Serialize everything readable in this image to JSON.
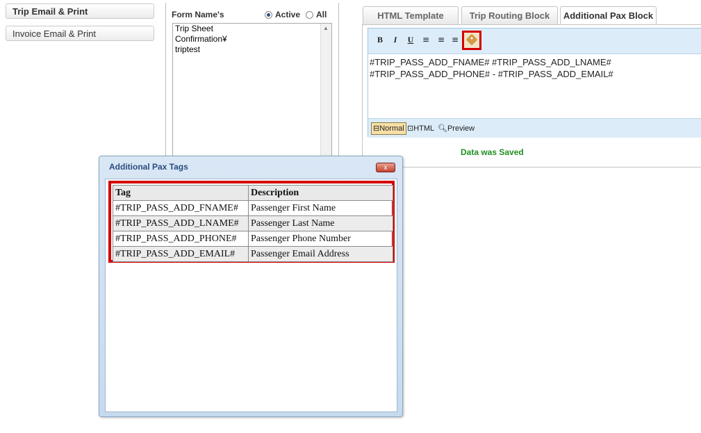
{
  "sidebar": {
    "items": [
      {
        "label": "Trip Email & Print",
        "active": true
      },
      {
        "label": "Invoice Email & Print",
        "active": false
      }
    ]
  },
  "forms": {
    "title": "Form Name's",
    "filter_active": "Active",
    "filter_all": "All",
    "selected_filter": "Active",
    "list": [
      "Trip Sheet",
      "Confirmation¥",
      "triptest"
    ]
  },
  "tabs": [
    {
      "label": "HTML Template",
      "active": false
    },
    {
      "label": "Trip Routing Block",
      "active": false
    },
    {
      "label": "Additional Pax Block",
      "active": true
    }
  ],
  "editor": {
    "toolbar": {
      "bold": "B",
      "italic": "I",
      "underline": "U"
    },
    "lines": [
      "#TRIP_PASS_ADD_FNAME# #TRIP_PASS_ADD_LNAME#",
      "#TRIP_PASS_ADD_PHONE# - #TRIP_PASS_ADD_EMAIL#"
    ],
    "modes": {
      "normal": "Normal",
      "html": "HTML",
      "preview": "Preview",
      "active": "Normal"
    }
  },
  "status": {
    "message": "Data was Saved",
    "color": "#1f8f1f"
  },
  "dialog": {
    "title": "Additional Pax Tags",
    "close_label": "x",
    "table": {
      "headers": [
        "Tag",
        "Description"
      ],
      "rows": [
        [
          "#TRIP_PASS_ADD_FNAME#",
          "Passenger First Name"
        ],
        [
          "#TRIP_PASS_ADD_LNAME#",
          "Passenger Last Name"
        ],
        [
          "#TRIP_PASS_ADD_PHONE#",
          "Passenger Phone Number"
        ],
        [
          "#TRIP_PASS_ADD_EMAIL#",
          "Passenger Email Address"
        ]
      ]
    }
  },
  "colors": {
    "highlight": "#d40000",
    "toolbar_bg": "#dcecf8",
    "dialog_title": "#2b4d7e"
  }
}
